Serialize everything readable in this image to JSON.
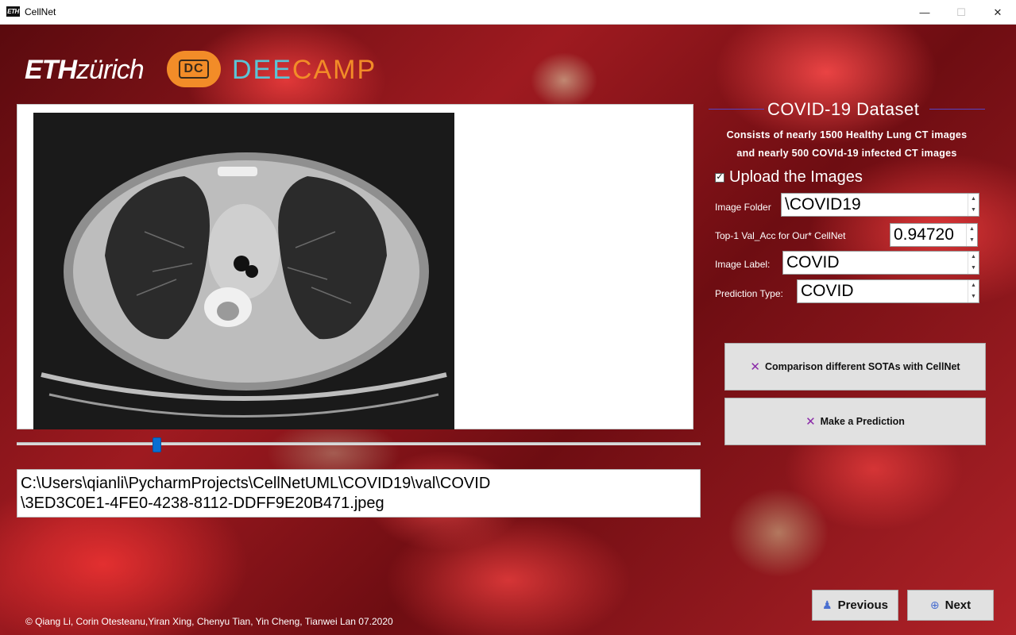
{
  "window": {
    "title": "CellNet",
    "icon_label": "ETH"
  },
  "logos": {
    "eth_bold": "ETH",
    "eth_rest": "zürich",
    "dc_badge": "DC",
    "deecamp_part1": "DEE",
    "deecamp_part2": "CAMP"
  },
  "dataset": {
    "title": "COVID-19  Dataset",
    "line1": "Consists of nearly 1500  Healthy  Lung CT  images",
    "line2": "and  nearly  500  COVId-19  infected  CT  images"
  },
  "upload": {
    "checked": true,
    "label": "Upload the Images"
  },
  "fields": {
    "image_folder_label": "Image Folder",
    "image_folder_value": "\\COVID19",
    "top1_label": "Top-1 Val_Acc for Our* CellNet",
    "top1_value": "0.94720",
    "image_label_label": "Image Label:",
    "image_label_value": "COVID",
    "prediction_type_label": "Prediction Type:",
    "prediction_type_value": "COVID"
  },
  "buttons": {
    "compare": "Comparison different SOTAs with CellNet",
    "predict": "Make a Prediction",
    "previous": "Previous",
    "next": "Next"
  },
  "file_path": {
    "line1": "C:\\Users\\qianli\\PycharmProjects\\CellNetUML\\COVID19\\val\\COVID",
    "line2": "\\3ED3C0E1-4FE0-4238-8112-DDFF9E20B471.jpeg"
  },
  "slider": {
    "position_fraction": 0.2
  },
  "footer": {
    "copyright": "© Qiang Li, Corin Otesteanu,Yiran Xing, Chenyu Tian, Yin Cheng, Tianwei Lan 07.2020"
  },
  "colors": {
    "accent_blue": "#0a6ed1",
    "deecamp_orange": "#f28c28",
    "deecamp_teal": "#5bc4d6",
    "icon_purple": "#8a2aa8"
  }
}
